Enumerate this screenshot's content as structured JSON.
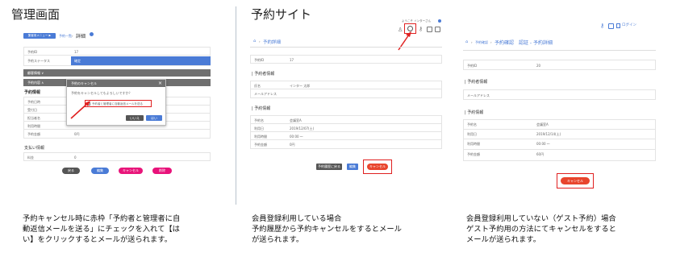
{
  "left": {
    "heading": "管理画面",
    "breadcrumb": {
      "tag": "集客用メニュー ▶",
      "link": "予約一覧",
      "sep": "›",
      "current": "詳細"
    },
    "table": [
      {
        "label": "予約ID",
        "value": "17"
      },
      {
        "label": "予約ステータス",
        "value": "確定"
      }
    ],
    "section_customer": "顧客情報",
    "section_reservation": "予約内容",
    "sub_reservation": "予約情報",
    "rows_reservation": [
      {
        "label": "予約日時",
        "value": ""
      },
      {
        "label": "受付日",
        "value": ""
      },
      {
        "label": "担当者名",
        "value": ""
      },
      {
        "label": "利用時間",
        "value": ""
      },
      {
        "label": "予約金額",
        "value": "0円"
      }
    ],
    "sub_payment": "支払い情報",
    "rows_payment": [
      {
        "label": "料金",
        "value": "0"
      }
    ],
    "modal": {
      "title": "予約のキャンセル",
      "close": "×",
      "question": "予約をキャンセルしてもよろしいですか？",
      "checkbox_label": "予約者と管理者に自動返信メールを送る",
      "no": "いいえ",
      "yes": "はい"
    },
    "buttons": [
      "戻る",
      "編集",
      "キャンセル",
      "削除"
    ],
    "caption": "予約キャンセル時に赤枠「予約者と管理者に自\n動返信メールを送る」にチェックを入れて【は\nい】をクリックするとメールが送られます。"
  },
  "middle": {
    "heading": "予約サイト",
    "topbar": "ようこそ インターさん",
    "breadcrumb": {
      "home": "⌂",
      "sep": "›",
      "current": "予約詳細"
    },
    "rows_top": [
      {
        "label": "予約ID",
        "value": "17"
      }
    ],
    "sub_person": "予約者情報",
    "rows_person": [
      {
        "label": "氏名",
        "value": "インター 太郎"
      },
      {
        "label": "メールアドレス",
        "value": ""
      }
    ],
    "sub_reservation": "予約情報",
    "rows_reservation": [
      {
        "label": "予約名",
        "value": "会議室A"
      },
      {
        "label": "利用日",
        "value": "2019/12/07(土)"
      },
      {
        "label": "利用時間",
        "value": "00:00 〜"
      },
      {
        "label": "予約金額",
        "value": "0円"
      }
    ],
    "buttons": {
      "history": "予約履歴に戻る",
      "edit": "編集",
      "cancel": "キャンセル"
    },
    "caption": "会員登録利用している場合\n予約履歴から予約キャンセルをするとメール\nが送られます。"
  },
  "right": {
    "login": "ログイン",
    "breadcrumb": {
      "home": "⌂",
      "sep": "›",
      "link": "予約確認",
      "current": "予約確認　認証 - 予約詳細"
    },
    "rows_top": [
      {
        "label": "予約ID",
        "value": "20"
      }
    ],
    "sub_person": "予約者情報",
    "rows_person": [
      {
        "label": "メールアドレス",
        "value": ""
      }
    ],
    "sub_reservation": "予約情報",
    "rows_reservation": [
      {
        "label": "予約名",
        "value": "会議室A"
      },
      {
        "label": "利用日",
        "value": "2019/12/14(土)"
      },
      {
        "label": "利用時間",
        "value": "00:00 〜"
      },
      {
        "label": "予約金額",
        "value": "60円"
      }
    ],
    "cancel": "キャンセル",
    "caption": "会員登録利用していない（ゲスト予約）場合\nゲスト予約用の方法にてキャンセルをすると\nメールが送られます。"
  },
  "colors": {
    "accent_blue": "#4a7bd6",
    "header_gray": "#6f6f6f",
    "cancel_pink": "#e8157a",
    "delete_pink": "#e8127a",
    "cancel_red": "#e8452d",
    "highlight_red": "#e02020"
  }
}
